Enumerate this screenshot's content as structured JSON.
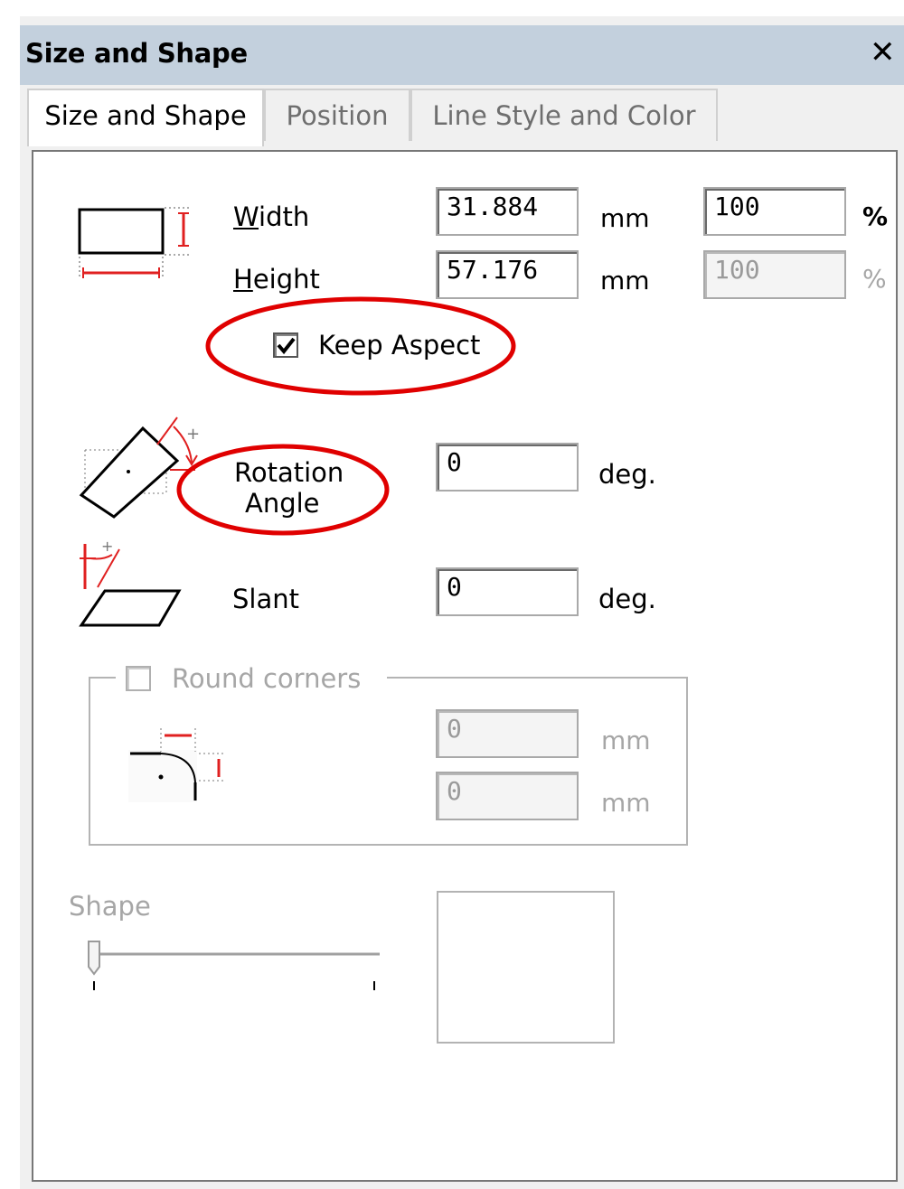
{
  "window": {
    "title": "Size and Shape",
    "close_symbol": "✕"
  },
  "tabs": [
    {
      "label": "Size and Shape",
      "active": true
    },
    {
      "label": "Position",
      "active": false
    },
    {
      "label": "Line Style and Color",
      "active": false
    }
  ],
  "size": {
    "width_label": "Width",
    "width_mnemonic": "W",
    "width_rest": "idth",
    "width_value": "31.884",
    "width_unit": "mm",
    "width_percent": "100",
    "width_percent_unit": "%",
    "height_label": "Height",
    "height_mnemonic": "H",
    "height_rest": "eight",
    "height_value": "57.176",
    "height_unit": "mm",
    "height_percent": "100",
    "height_percent_unit": "%",
    "keep_aspect_label": "Keep Aspect",
    "keep_aspect_checked": true
  },
  "rotation": {
    "label_line1": "Rotation",
    "label_line2": "Angle",
    "value": "0",
    "unit": "deg."
  },
  "slant": {
    "label": "Slant",
    "value": "0",
    "unit": "deg."
  },
  "round_corners": {
    "label": "Round corners",
    "checked": false,
    "value1": "0",
    "unit1": "mm",
    "value2": "0",
    "unit2": "mm"
  },
  "shape": {
    "label": "Shape",
    "slider_value": 0
  },
  "colors": {
    "annotation_red": "#e00000",
    "titlebar": "#c3d0dd",
    "icon_red": "#e02020"
  }
}
